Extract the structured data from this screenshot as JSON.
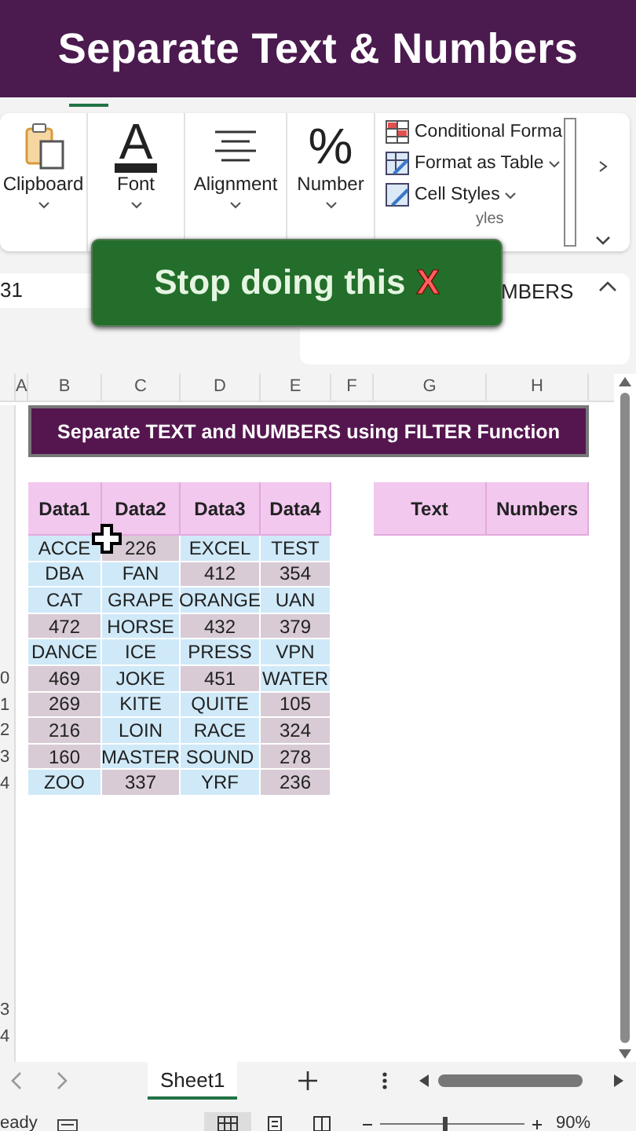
{
  "banner": {
    "title": "Separate Text & Numbers"
  },
  "ribbon": {
    "groups": [
      {
        "kind": "clipboard",
        "label": "Clipboard"
      },
      {
        "kind": "glyph",
        "glyph": "A",
        "label": "Font"
      },
      {
        "kind": "alignment",
        "label": "Alignment"
      },
      {
        "kind": "glyph",
        "glyph": "%",
        "label": "Number"
      }
    ],
    "styles": [
      {
        "kind": "conditional",
        "label": "Conditional Forma"
      },
      {
        "kind": "table",
        "label": "Format as Table"
      },
      {
        "kind": "cell",
        "label": "Cell Styles"
      }
    ],
    "styles_caption": "yles"
  },
  "formula_bar": {
    "name_box": "31",
    "content": "MBERS"
  },
  "callout": {
    "text": "Stop doing this",
    "mark": "X"
  },
  "columns": [
    "A",
    "B",
    "C",
    "D",
    "E",
    "F",
    "G",
    "H"
  ],
  "sheet": {
    "title": "Separate TEXT and NUMBERS using FILTER Function",
    "headers": [
      "Data1",
      "Data2",
      "Data3",
      "Data4"
    ],
    "result_headers": [
      "Text",
      "Numbers"
    ],
    "rows": [
      {
        "cells": [
          {
            "text": "ACCE",
            "kind": "text"
          },
          {
            "text": "226",
            "kind": "number"
          },
          {
            "text": "EXCEL",
            "kind": "text"
          },
          {
            "text": "TEST",
            "kind": "text"
          }
        ]
      },
      {
        "cells": [
          {
            "text": "DBA",
            "kind": "text"
          },
          {
            "text": "FAN",
            "kind": "text"
          },
          {
            "text": "412",
            "kind": "number"
          },
          {
            "text": "354",
            "kind": "number"
          }
        ]
      },
      {
        "cells": [
          {
            "text": "CAT",
            "kind": "text"
          },
          {
            "text": "GRAPE",
            "kind": "text"
          },
          {
            "text": "ORANGE",
            "kind": "text"
          },
          {
            "text": "UAN",
            "kind": "text"
          }
        ]
      },
      {
        "cells": [
          {
            "text": "472",
            "kind": "number"
          },
          {
            "text": "HORSE",
            "kind": "text"
          },
          {
            "text": "432",
            "kind": "number"
          },
          {
            "text": "379",
            "kind": "number"
          }
        ]
      },
      {
        "cells": [
          {
            "text": "DANCE",
            "kind": "text"
          },
          {
            "text": "ICE",
            "kind": "text"
          },
          {
            "text": "PRESS",
            "kind": "text"
          },
          {
            "text": "VPN",
            "kind": "text"
          }
        ]
      },
      {
        "row_label": "0",
        "cells": [
          {
            "text": "469",
            "kind": "number"
          },
          {
            "text": "JOKE",
            "kind": "text"
          },
          {
            "text": "451",
            "kind": "number"
          },
          {
            "text": "WATER",
            "kind": "text"
          }
        ]
      },
      {
        "row_label": "1",
        "cells": [
          {
            "text": "269",
            "kind": "number"
          },
          {
            "text": "KITE",
            "kind": "text"
          },
          {
            "text": "QUITE",
            "kind": "text"
          },
          {
            "text": "105",
            "kind": "number"
          }
        ]
      },
      {
        "row_label": "2",
        "cells": [
          {
            "text": "216",
            "kind": "number"
          },
          {
            "text": "LOIN",
            "kind": "text"
          },
          {
            "text": "RACE",
            "kind": "text"
          },
          {
            "text": "324",
            "kind": "number"
          }
        ]
      },
      {
        "row_label": "3",
        "cells": [
          {
            "text": "160",
            "kind": "number"
          },
          {
            "text": "MASTER",
            "kind": "text"
          },
          {
            "text": "SOUND",
            "kind": "text"
          },
          {
            "text": "278",
            "kind": "number"
          }
        ]
      },
      {
        "row_label": "4",
        "cells": [
          {
            "text": "ZOO",
            "kind": "text"
          },
          {
            "text": "337",
            "kind": "number"
          },
          {
            "text": "YRF",
            "kind": "text"
          },
          {
            "text": "236",
            "kind": "number"
          }
        ]
      }
    ],
    "bottom_row_labels": [
      "3",
      "4"
    ]
  },
  "sheet_tabs": [
    {
      "label": "Sheet1",
      "selected": true
    }
  ],
  "status_bar": {
    "status": "eady",
    "views": [
      {
        "kind": "normal",
        "selected": true
      },
      {
        "kind": "layout",
        "selected": false
      },
      {
        "kind": "break",
        "selected": false
      }
    ],
    "zoom": {
      "level": 0.44,
      "reading": "90%"
    }
  }
}
